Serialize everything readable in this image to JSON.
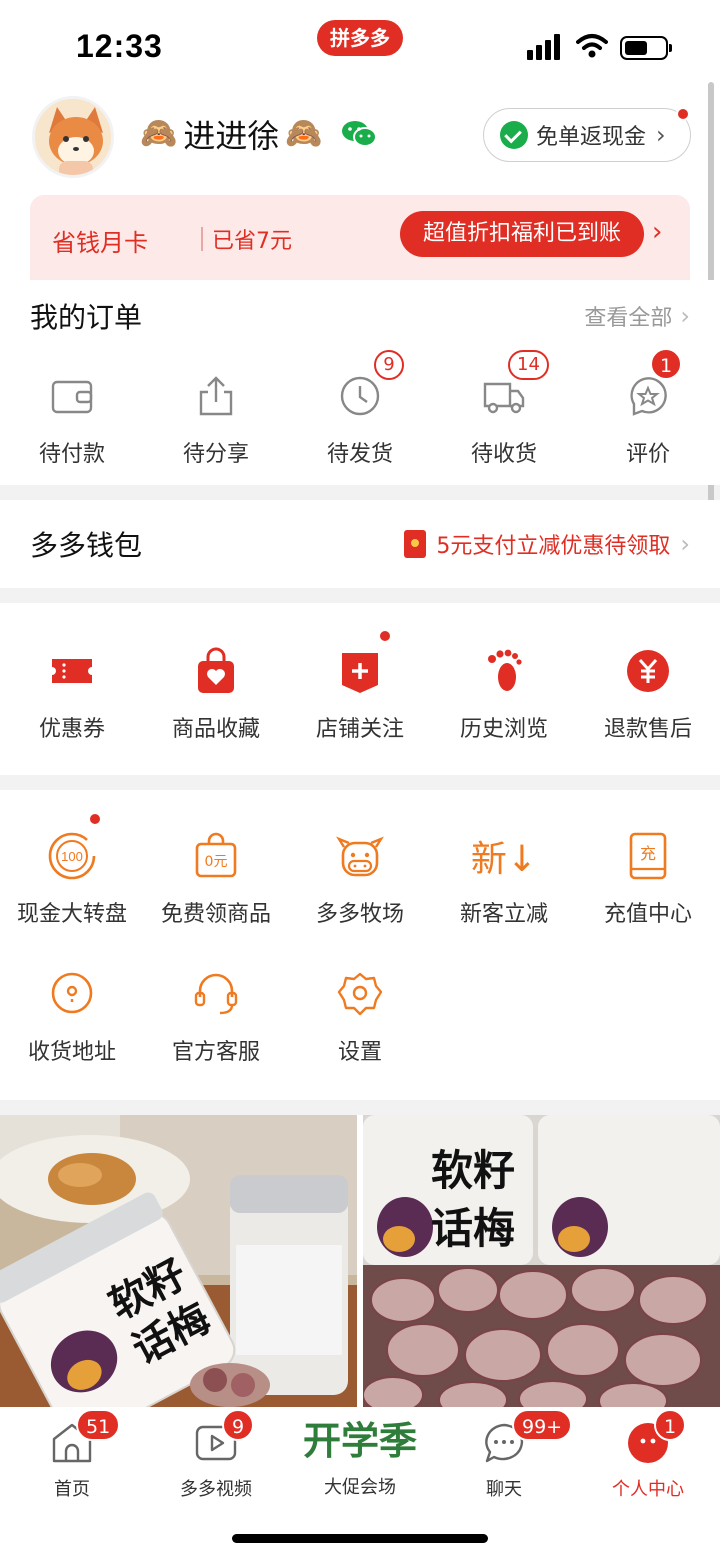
{
  "status_bar": {
    "time": "12:33",
    "app_pill": "拼多多"
  },
  "profile": {
    "username": "进进徐",
    "monkey_left": "🙈",
    "monkey_right": "🙈",
    "cashback_label": "免单返现金"
  },
  "save_card": {
    "title": "省钱月卡",
    "saved": "已省7元",
    "button_label": "超值折扣福利已到账"
  },
  "orders": {
    "title": "我的订单",
    "see_all": "查看全部",
    "items": [
      {
        "label": "待付款",
        "icon": "wallet-icon",
        "badge": ""
      },
      {
        "label": "待分享",
        "icon": "share-icon",
        "badge": ""
      },
      {
        "label": "待发货",
        "icon": "clock-icon",
        "badge": "9"
      },
      {
        "label": "待收货",
        "icon": "truck-icon",
        "badge": "14"
      },
      {
        "label": "评价",
        "icon": "review-icon",
        "badge": "1"
      }
    ]
  },
  "wallet": {
    "title": "多多钱包",
    "promo": "5元支付立减优惠待领取"
  },
  "quick_actions": [
    {
      "label": "优惠券",
      "icon": "coupon-icon"
    },
    {
      "label": "商品收藏",
      "icon": "favorite-bag-icon"
    },
    {
      "label": "店铺关注",
      "icon": "store-follow-icon"
    },
    {
      "label": "历史浏览",
      "icon": "footprint-icon"
    },
    {
      "label": "退款售后",
      "icon": "refund-icon"
    }
  ],
  "tools": [
    {
      "label": "现金大转盘",
      "icon": "wheel-icon",
      "glyph": "100"
    },
    {
      "label": "免费领商品",
      "icon": "free-bag-icon",
      "glyph": "0元"
    },
    {
      "label": "多多牧场",
      "icon": "cow-icon"
    },
    {
      "label": "新客立减",
      "icon": "new-customer-icon",
      "glyph": "新↓"
    },
    {
      "label": "充值中心",
      "icon": "recharge-icon",
      "glyph": "充"
    },
    {
      "label": "收货地址",
      "icon": "location-icon"
    },
    {
      "label": "官方客服",
      "icon": "headset-icon"
    },
    {
      "label": "设置",
      "icon": "settings-icon"
    }
  ],
  "products": [
    {
      "label_line1": "软籽",
      "label_line2": "话梅"
    },
    {
      "label_line1": "软籽",
      "label_line2": "话梅"
    }
  ],
  "tabbar": [
    {
      "label": "首页",
      "badge": "51",
      "icon": "home-icon"
    },
    {
      "label": "多多视频",
      "badge": "9",
      "icon": "video-icon"
    },
    {
      "label": "大促会场",
      "badge": "",
      "icon": "promo-icon",
      "banner": "开学季"
    },
    {
      "label": "聊天",
      "badge": "99+",
      "icon": "chat-icon"
    },
    {
      "label": "个人中心",
      "badge": "1",
      "icon": "profile-icon"
    }
  ],
  "colors": {
    "brand_red": "#e02e24",
    "tool_orange": "#ef7a20",
    "promo_green": "#2f7d3b"
  }
}
